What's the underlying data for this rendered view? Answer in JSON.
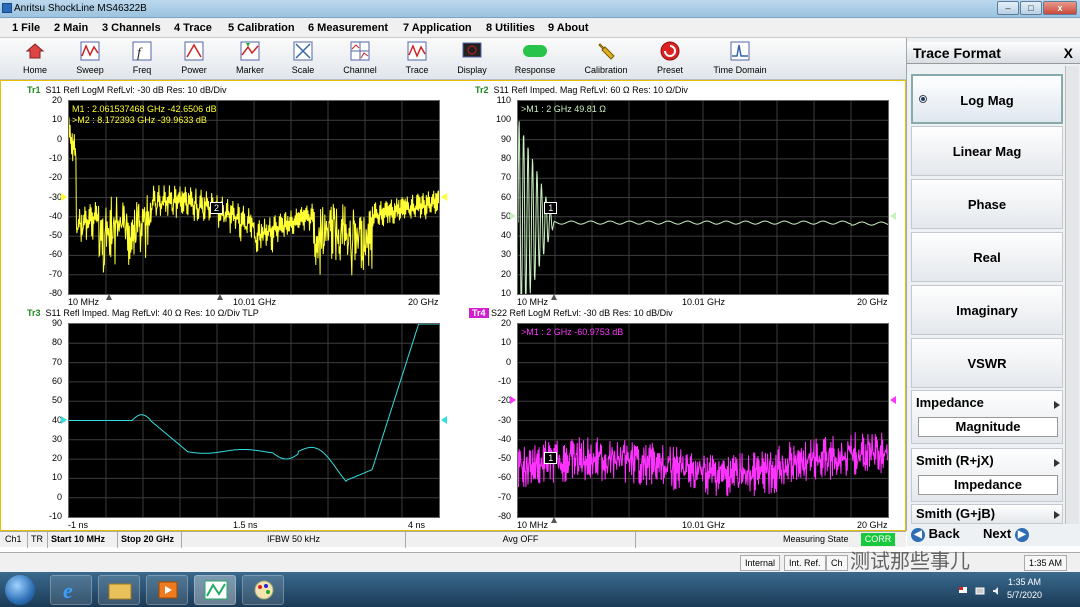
{
  "window": {
    "title": "Anritsu ShockLine MS46322B"
  },
  "menu": [
    {
      "label": "1 File"
    },
    {
      "label": "2 Main"
    },
    {
      "label": "3 Channels"
    },
    {
      "label": "4 Trace"
    },
    {
      "label": "5 Calibration"
    },
    {
      "label": "6 Measurement"
    },
    {
      "label": "7 Application"
    },
    {
      "label": "8 Utilities"
    },
    {
      "label": "9 About"
    }
  ],
  "toolbar": [
    {
      "label": "Home",
      "icon": "home-icon"
    },
    {
      "label": "Sweep",
      "icon": "sweep-icon"
    },
    {
      "label": "Freq",
      "icon": "freq-icon"
    },
    {
      "label": "Power",
      "icon": "power-icon"
    },
    {
      "label": "Marker",
      "icon": "marker-icon"
    },
    {
      "label": "Scale",
      "icon": "scale-icon"
    },
    {
      "label": "Channel",
      "icon": "channel-icon"
    },
    {
      "label": "Trace",
      "icon": "trace-icon"
    },
    {
      "label": "Display",
      "icon": "display-icon"
    },
    {
      "label": "Response",
      "icon": "response-icon"
    },
    {
      "label": "Calibration",
      "icon": "calibration-icon"
    },
    {
      "label": "Preset",
      "icon": "preset-icon"
    },
    {
      "label": "Time Domain",
      "icon": "time-domain-icon"
    }
  ],
  "toolbar_extra": {
    "response_badge": "log/Sig"
  },
  "traces": [
    {
      "tag": "Tr1",
      "header": "S11 Refl LogM RefLvl: -30  dB Res: 10  dB/Div",
      "color": "#ffff33",
      "yticks": [
        "20",
        "10",
        "0",
        "-10",
        "-20",
        "-30",
        "-40",
        "-50",
        "-60",
        "-70",
        "-80"
      ],
      "xticks": [
        "10 MHz",
        "10.01 GHz",
        "20 GHz"
      ],
      "markers": [
        "M1 :  2.061537468 GHz  -42.6506  dB",
        ">M2 :  8.172393 GHz  -39.9633  dB"
      ],
      "marker_box": "2"
    },
    {
      "tag": "Tr2",
      "header": "S11 Refl Imped. Mag RefLvl: 60  Ω Res: 10  Ω/Div",
      "color": "#c9f0c0",
      "yticks": [
        "110",
        "100",
        "90",
        "80",
        "70",
        "60",
        "50",
        "40",
        "30",
        "20",
        "10"
      ],
      "xticks": [
        "10 MHz",
        "10.01 GHz",
        "20 GHz"
      ],
      "markers": [
        ">M1 :  2 GHz  49.81  Ω"
      ],
      "marker_box": "1"
    },
    {
      "tag": "Tr3",
      "header": "S11 Refl Imped. Mag RefLvl: 40  Ω Res: 10  Ω/Div  TLP",
      "color": "#33dddd",
      "yticks": [
        "90",
        "80",
        "70",
        "60",
        "50",
        "40",
        "30",
        "20",
        "10",
        "0",
        "-10"
      ],
      "xticks": [
        "-1 ns",
        "1.5 ns",
        "4 ns"
      ],
      "markers": [],
      "marker_box": ""
    },
    {
      "tag": "Tr4",
      "header": "S22 Refl LogM RefLvl: -30  dB Res: 10  dB/Div",
      "color": "#ff33ff",
      "yticks": [
        "20",
        "10",
        "0",
        "-10",
        "-20",
        "-30",
        "-40",
        "-50",
        "-60",
        "-70",
        "-80"
      ],
      "xticks": [
        "10 MHz",
        "10.01 GHz",
        "20 GHz"
      ],
      "markers": [
        ">M1 :  2 GHz  -60.9753  dB"
      ],
      "marker_box": "1"
    }
  ],
  "panel": {
    "title": "Trace Format",
    "close": "X",
    "options": [
      {
        "label": "Log Mag",
        "selected": true
      },
      {
        "label": "Linear Mag"
      },
      {
        "label": "Phase"
      },
      {
        "label": "Real"
      },
      {
        "label": "Imaginary"
      },
      {
        "label": "VSWR"
      }
    ],
    "sub1": {
      "title": "Impedance",
      "value": "Magnitude"
    },
    "sub2": {
      "title": "Smith (R+jX)",
      "value": "Impedance"
    },
    "sub3": {
      "title": "Smith (G+jB)"
    },
    "back": "Back",
    "next": "Next"
  },
  "status": {
    "ch": "Ch1",
    "tr": "TR",
    "start": "Start 10 MHz",
    "stop": "Stop 20 GHz",
    "ifbw": "IFBW 50 kHz",
    "avg": "Avg OFF",
    "measuring": "Measuring State",
    "corr": "CORR"
  },
  "status2": {
    "internal": "Internal",
    "intref": "Int. Ref.",
    "ch": "Ch",
    "time": "1:35 AM"
  },
  "taskbar": {
    "time": "1:35 AM",
    "date": "5/7/2020"
  },
  "watermark": "测试那些事儿",
  "colors": {
    "accent_green": "#19c93c",
    "plot_bg": "#000000",
    "frame": "#e6c000"
  }
}
